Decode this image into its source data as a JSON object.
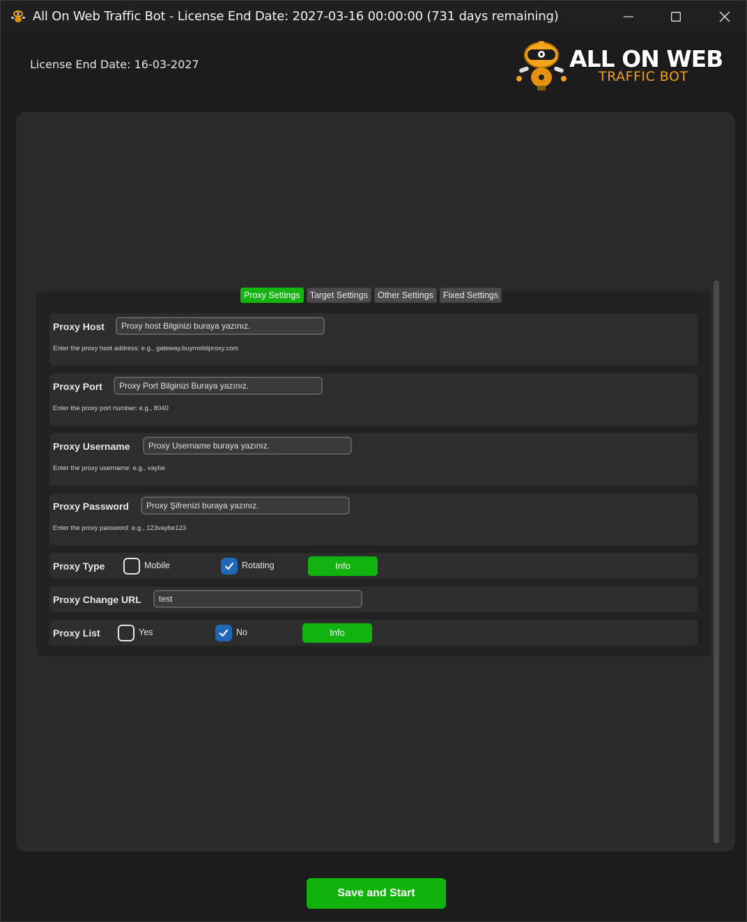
{
  "window": {
    "title": "All On Web Traffic Bot - License End Date: 2027-03-16 00:00:00 (731 days remaining)",
    "app_icon": "robot-icon",
    "controls": {
      "minimize": "minimize-icon",
      "maximize": "maximize-icon",
      "close": "close-icon"
    }
  },
  "header": {
    "license_text": "License End Date: 16-03-2027",
    "logo_title": "ALL ON WEB",
    "logo_subtitle": "TRAFFIC BOT"
  },
  "tabs": [
    {
      "label": "Proxy Settings",
      "active": true
    },
    {
      "label": "Target Settings",
      "active": false
    },
    {
      "label": "Other Settings",
      "active": false
    },
    {
      "label": "Fixed Settings",
      "active": false
    }
  ],
  "proxy": {
    "host": {
      "label": "Proxy Host",
      "value": "Proxy host Bilginizi buraya yazınız.",
      "hint": "Enter the proxy host address: e.g., gateway.buymobilproxy.com"
    },
    "port": {
      "label": "Proxy Port",
      "value": "Proxy Port Bilginizi Buraya yazınız.",
      "hint": "Enter the proxy port number: e.g., 8040"
    },
    "username": {
      "label": "Proxy Username",
      "value": "Proxy Username buraya yazınız.",
      "hint": "Enter the proxy username: e.g., vaybe"
    },
    "password": {
      "label": "Proxy Password",
      "value": "Proxy Şifrenizi buraya yazınız.",
      "hint": "Enter the proxy password: e.g., 123vaybe123"
    },
    "type": {
      "label": "Proxy Type",
      "option_a": "Mobile",
      "option_a_checked": false,
      "option_b": "Rotating",
      "option_b_checked": true,
      "info_label": "Info"
    },
    "change_url": {
      "label": "Proxy Change URL",
      "value": "test"
    },
    "list": {
      "label": "Proxy List",
      "option_a": "Yes",
      "option_a_checked": false,
      "option_b": "No",
      "option_b_checked": true,
      "info_label": "Info"
    }
  },
  "footer": {
    "save_label": "Save and Start"
  },
  "colors": {
    "accent_green": "#11b30e",
    "checkbox_blue": "#1f67b8",
    "logo_orange": "#f6a21a"
  }
}
